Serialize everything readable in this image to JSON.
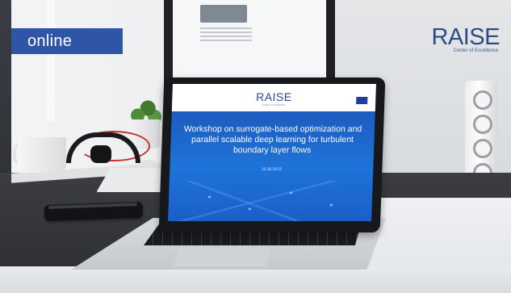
{
  "badge": {
    "label": "online"
  },
  "brand": {
    "name": "RAISE",
    "subtitle": "Center of Excellence"
  },
  "laptop_screen": {
    "logo": "RAISE",
    "logo_subtitle": "Center of Excellence",
    "title": "Workshop on surrogate-based optimization and parallel scalable deep learning for turbulent boundary layer flows",
    "date": "15.06.2023"
  },
  "colors": {
    "badge_bg": "#2f56a6",
    "brand_text": "#2c4a88",
    "screen_blue": "#1f73d8"
  }
}
